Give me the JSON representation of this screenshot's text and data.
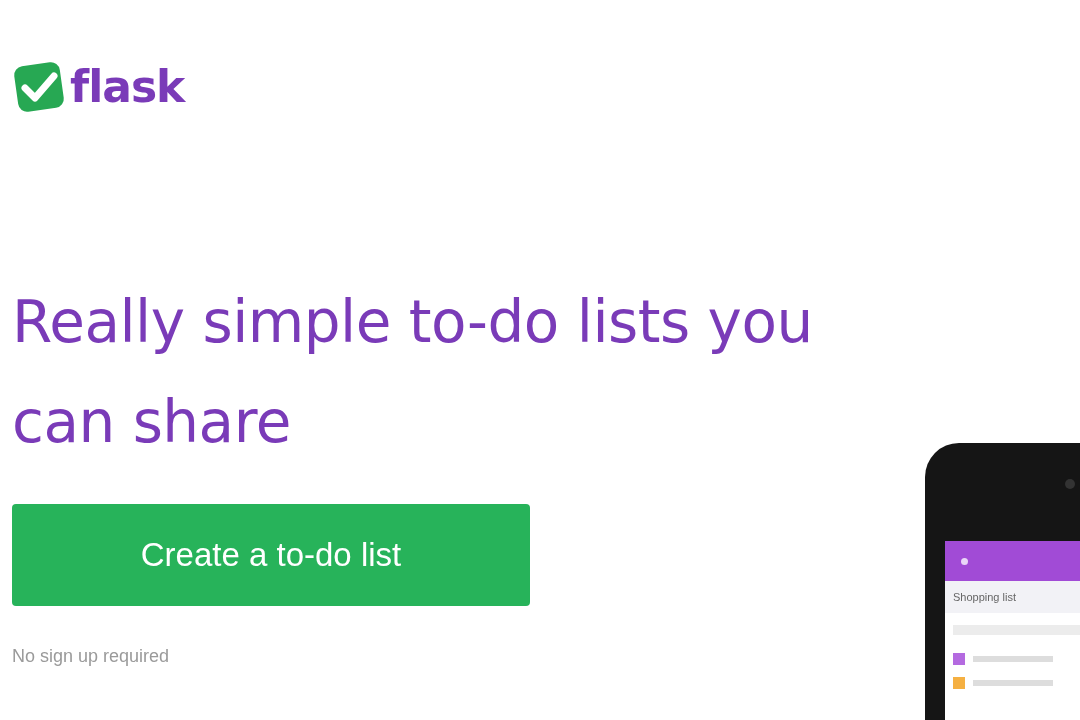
{
  "logo": {
    "text": "flask"
  },
  "headline": "Really simple to-do lists you can share",
  "cta_button": {
    "label": "Create a to-do list"
  },
  "note": "No sign up required",
  "phone": {
    "list_title": "Shopping list",
    "items": [
      {
        "color": "#b46ae0"
      },
      {
        "color": "#f5b042"
      }
    ]
  }
}
